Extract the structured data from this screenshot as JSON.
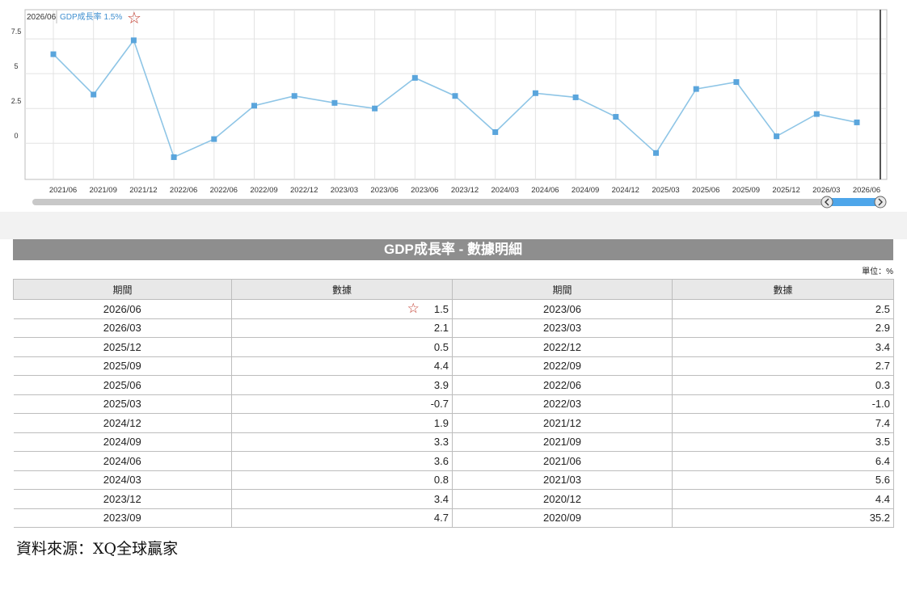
{
  "chart_data": {
    "type": "line",
    "legend": {
      "period": "2026/06",
      "label": "GDP成長率 1.5%",
      "star": "☆"
    },
    "categories": [
      "2021/06",
      "2021/09",
      "2021/12",
      "2022/06",
      "2022/06",
      "2022/09",
      "2022/12",
      "2023/03",
      "2023/06",
      "2023/06",
      "2023/12",
      "2024/03",
      "2024/06",
      "2024/09",
      "2024/12",
      "2025/03",
      "2025/06",
      "2025/09",
      "2025/12",
      "2026/03",
      "2026/06"
    ],
    "values": [
      6.4,
      3.5,
      7.4,
      -1.0,
      0.3,
      2.7,
      3.4,
      2.9,
      2.5,
      4.7,
      3.4,
      0.8,
      3.6,
      3.3,
      1.9,
      -0.7,
      3.9,
      4.4,
      0.5,
      2.1,
      1.5
    ],
    "yticks": [
      "7.5",
      "5",
      "2.5",
      "0"
    ],
    "ylim": [
      -2.6,
      9.6
    ],
    "grid": true,
    "line_color": "#8ec5e6",
    "marker_color": "#5aa5dc"
  },
  "table": {
    "title": "GDP成長率 - 數據明細",
    "unit": "單位：%",
    "headers": [
      "期間",
      "數據",
      "期間",
      "數據"
    ],
    "star": "☆",
    "rows": [
      [
        "2026/06",
        "1.5",
        "2023/06",
        "2.5"
      ],
      [
        "2026/03",
        "2.1",
        "2023/03",
        "2.9"
      ],
      [
        "2025/12",
        "0.5",
        "2022/12",
        "3.4"
      ],
      [
        "2025/09",
        "4.4",
        "2022/09",
        "2.7"
      ],
      [
        "2025/06",
        "3.9",
        "2022/06",
        "0.3"
      ],
      [
        "2025/03",
        "-0.7",
        "2022/03",
        "-1.0"
      ],
      [
        "2024/12",
        "1.9",
        "2021/12",
        "7.4"
      ],
      [
        "2024/09",
        "3.3",
        "2021/09",
        "3.5"
      ],
      [
        "2024/06",
        "3.6",
        "2021/06",
        "6.4"
      ],
      [
        "2024/03",
        "0.8",
        "2021/03",
        "5.6"
      ],
      [
        "2023/12",
        "3.4",
        "2020/12",
        "4.4"
      ],
      [
        "2023/09",
        "4.7",
        "2020/09",
        "35.2"
      ]
    ]
  },
  "source": "資料來源：XQ全球贏家",
  "scrollbar": {
    "left_icon": "chevron-left-icon",
    "right_icon": "chevron-right-icon"
  }
}
